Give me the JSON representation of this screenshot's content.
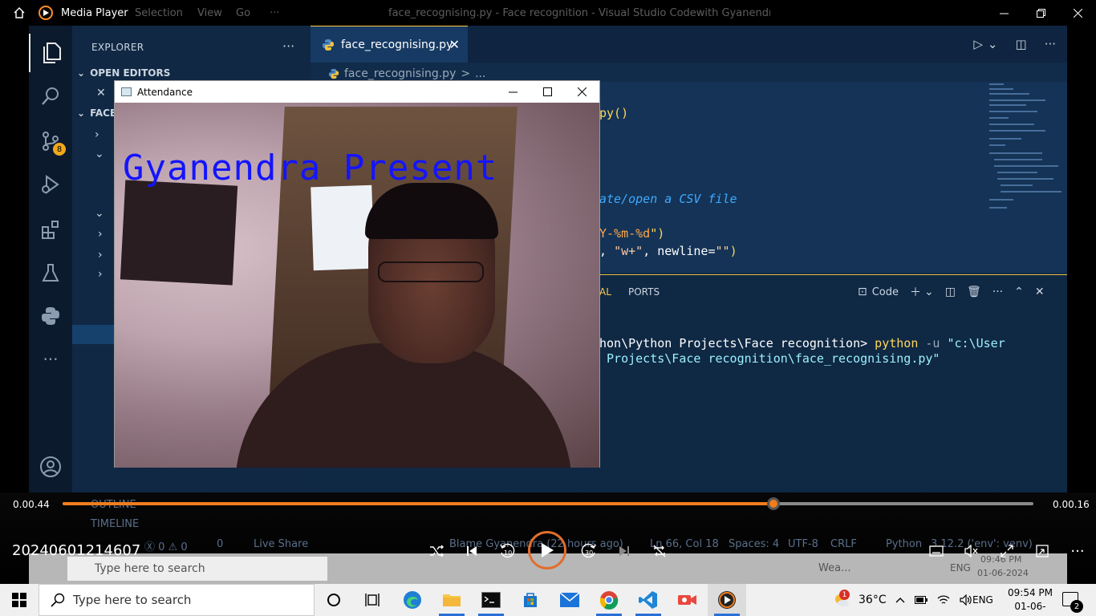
{
  "player": {
    "title": "Media Player",
    "current_time": "0.00.44",
    "total_time": "0.00.16",
    "progress": 0.732,
    "file_name": "20240601214607",
    "controls": {
      "shuffle": "shuffle-icon",
      "previous": "previous-icon",
      "rewind": "rewind-10-icon",
      "rewind_label": "10",
      "play": "play-icon",
      "forward": "forward-30-icon",
      "forward_label": "30",
      "next": "next-icon",
      "repeat": "repeat-off-icon"
    },
    "accent": "#f07d1e"
  },
  "ghost_titlebar": {
    "menu": [
      "Selection",
      "View",
      "Go",
      "···"
    ],
    "search": "face_recognising.py - Face recognition - Visual Studio Codewith Gyanendra Tiw"
  },
  "vscode": {
    "explorer_title": "EXPLORER",
    "open_editors": "OPEN EDITORS",
    "face_section": "FACE",
    "outline": "OUTLINE",
    "timeline": "TIMELINE",
    "scm_badge": "8",
    "tab_label": "face_recognising.py",
    "breadcrumb_file": "face_recognising.py",
    "breadcrumb_sep": ">",
    "breadcrumb_more": "...",
    "code": {
      "line1": "py()",
      "line2": "ate/open a CSV file",
      "line3_a": "Y-%m-%d",
      "line3_b": "\")",
      "line4_a": ", ",
      "line4_str": "\"w+\"",
      "line4_b": ", newline=",
      "line4_str2": "\"\"",
      "line4_c": ")"
    },
    "panel_tabs": [
      "AL",
      "PORTS"
    ],
    "panel_shell": "Code",
    "terminal": {
      "line1_path": "hon\\Python Projects\\Face recognition> ",
      "line1_cmd": "python",
      "line1_flag": " -u ",
      "line1_arg": "\"c:\\User",
      "line2": " Projects\\Face recognition\\face_recognising.py\""
    },
    "status": {
      "left": "Ⓧ 0 ⚠ 0",
      "ports": "0",
      "live_share": "Live Share",
      "blame": "Blame Gyanendra (22 hours ago)",
      "position": "Ln 66, Col 18",
      "spaces": "Spaces: 4",
      "encoding": "UTF-8",
      "eol": "CRLF",
      "language": "Python",
      "interpreter": "3.12.2 ('env': venv)"
    }
  },
  "attendance": {
    "title": "Attendance",
    "overlay_text": "Gyanendra Present",
    "overlay_color": "#1414ff"
  },
  "ghost_taskbar": {
    "search": "Type here to search",
    "weather": "Wea...",
    "lang": "ENG",
    "time": "09:46 PM",
    "date": "01-06-2024"
  },
  "taskbar": {
    "search_placeholder": "Type here to search",
    "weather_temp": "36°C",
    "weather_badge": "1",
    "language": "ENG",
    "time": "09:54 PM",
    "date": "01-06-2024",
    "notification_count": "2"
  }
}
